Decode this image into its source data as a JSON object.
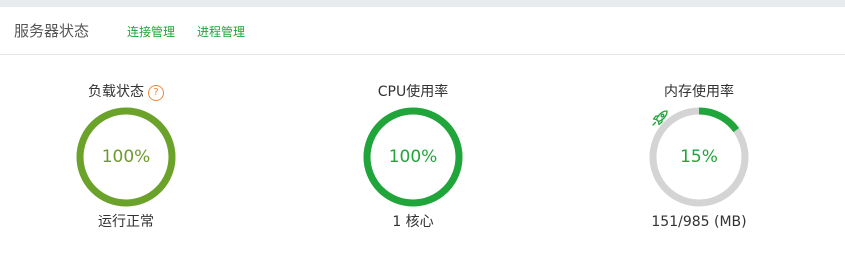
{
  "header": {
    "title": "服务器状态",
    "links": [
      {
        "label": "连接管理"
      },
      {
        "label": "进程管理"
      }
    ]
  },
  "colors": {
    "accent": "#20a53a",
    "load_ring": "#6ba32a",
    "track": "#d4d4d4",
    "help": "#f0883a"
  },
  "stats": [
    {
      "title": "负载状态",
      "value_text": "100%",
      "percent": 100,
      "caption": "运行正常",
      "help_icon": "question-circle-icon"
    },
    {
      "title": "CPU使用率",
      "value_text": "100%",
      "percent": 100,
      "caption": "1 核心"
    },
    {
      "title": "内存使用率",
      "value_text": "15%",
      "percent": 15,
      "caption": "151/985 (MB)",
      "icon": "rocket-icon"
    }
  ]
}
